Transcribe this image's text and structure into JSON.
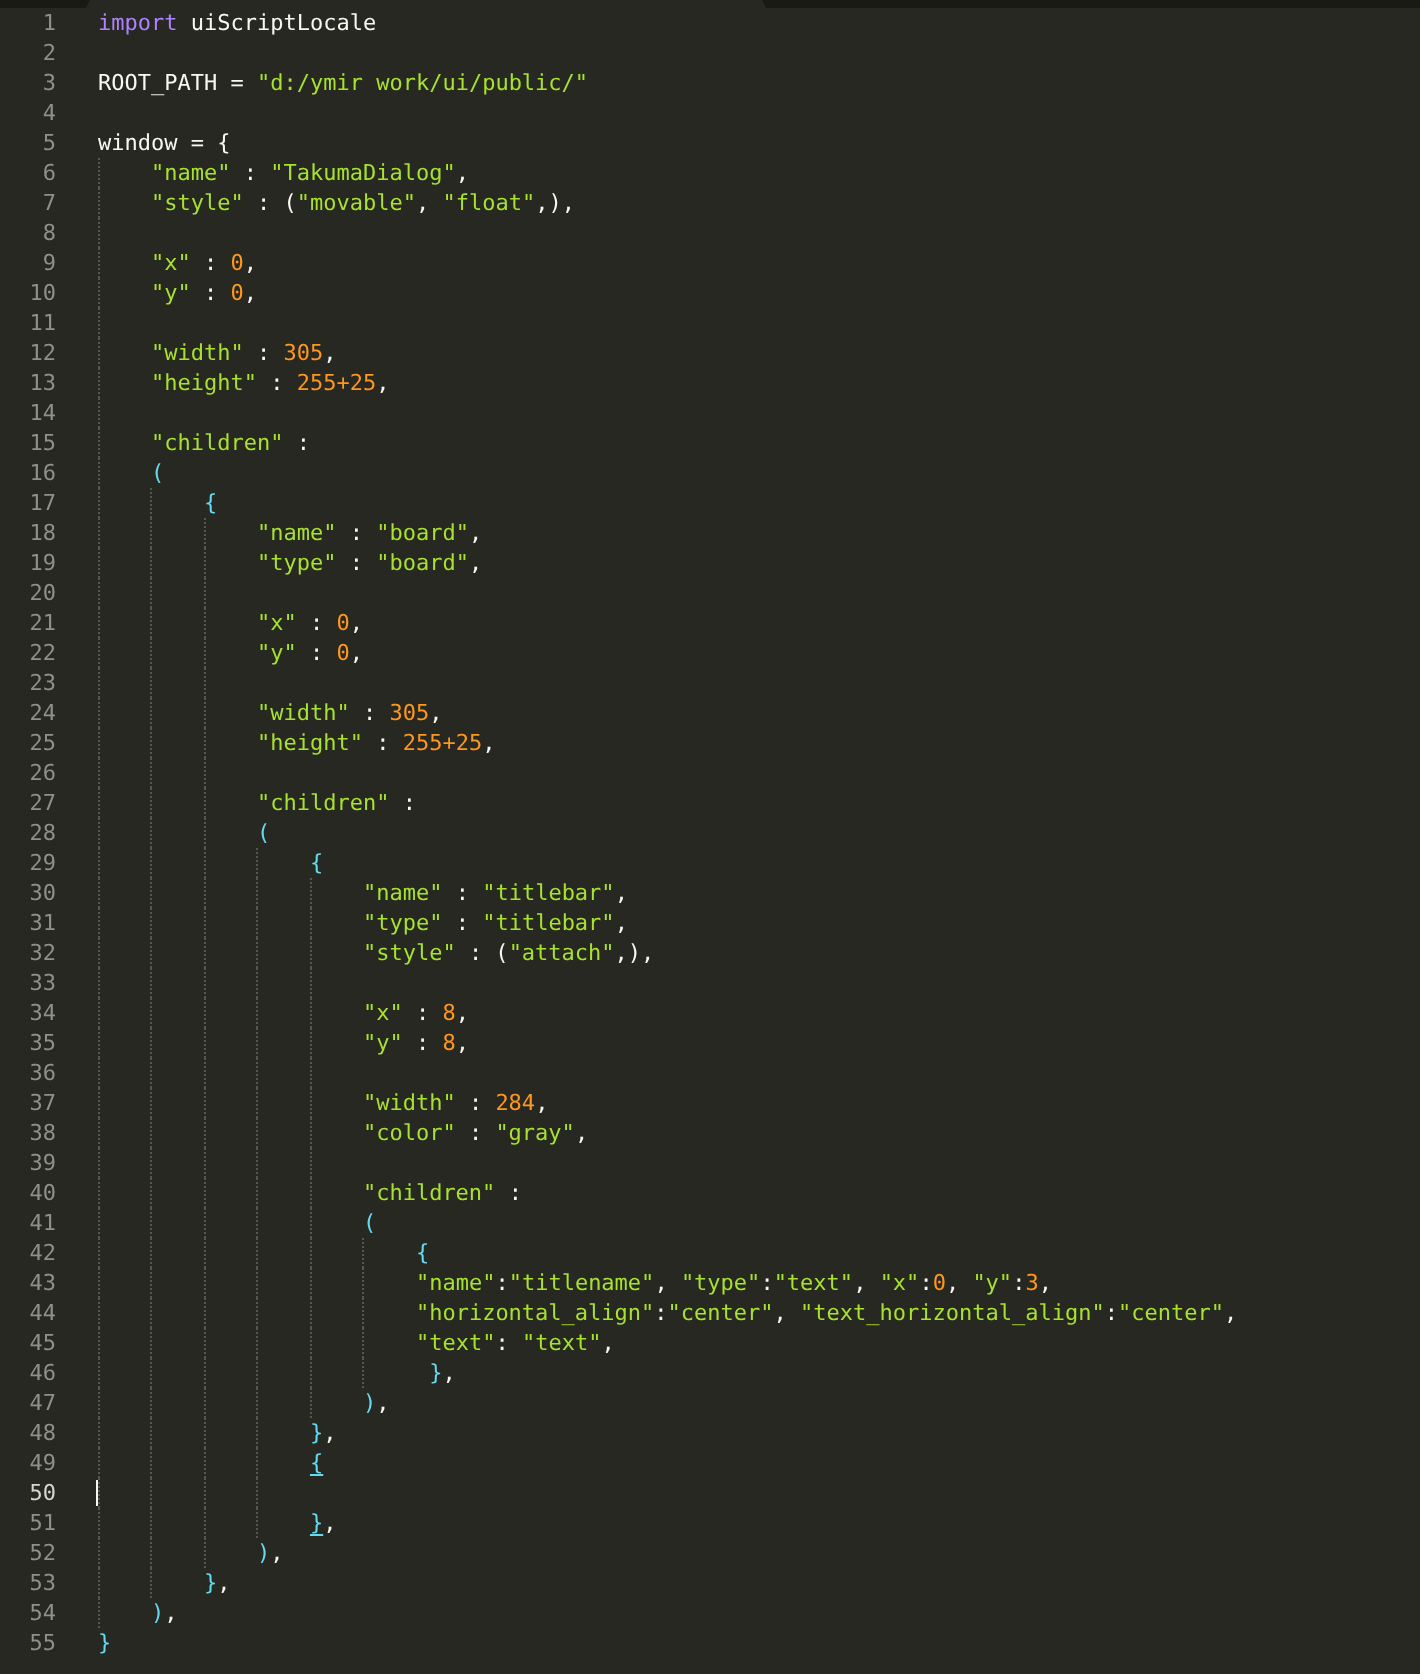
{
  "tab_bar": {
    "tab": {
      "selected": true
    }
  },
  "lines": [
    {
      "number": "1",
      "current": false,
      "tokens": [
        {
          "kind": "keyword",
          "text": "import"
        },
        {
          "kind": "plain",
          "text": " uiScriptLocale"
        }
      ]
    },
    {
      "number": "2",
      "current": false
    },
    {
      "number": "3",
      "current": false,
      "tokens": [
        {
          "kind": "plain",
          "text": "ROOT_PATH = "
        },
        {
          "kind": "string",
          "text": "\"d:/ymir work/ui/public/\""
        }
      ]
    },
    {
      "number": "4",
      "current": false
    },
    {
      "number": "5",
      "current": false,
      "tokens": [
        {
          "kind": "plain",
          "text": "window = {"
        }
      ]
    },
    {
      "number": "6",
      "current": false,
      "tokens": [
        {
          "kind": "string",
          "text": "    \"name\""
        },
        {
          "kind": "plain",
          "text": " : "
        },
        {
          "kind": "string",
          "text": "\"TakumaDialog\""
        },
        {
          "kind": "plain",
          "text": ","
        }
      ]
    },
    {
      "number": "7",
      "current": false,
      "tokens": [
        {
          "kind": "string",
          "text": "    \"style\""
        },
        {
          "kind": "plain",
          "text": " : ("
        },
        {
          "kind": "string",
          "text": "\"movable\""
        },
        {
          "kind": "plain",
          "text": ", "
        },
        {
          "kind": "string",
          "text": "\"float\""
        },
        {
          "kind": "plain",
          "text": ",),"
        }
      ]
    },
    {
      "number": "8",
      "current": false
    },
    {
      "number": "9",
      "current": false,
      "tokens": [
        {
          "kind": "string",
          "text": "    \"x\""
        },
        {
          "kind": "plain",
          "text": " : "
        },
        {
          "kind": "number",
          "text": "0"
        },
        {
          "kind": "plain",
          "text": ","
        }
      ]
    },
    {
      "number": "10",
      "current": false,
      "tokens": [
        {
          "kind": "string",
          "text": "    \"y\""
        },
        {
          "kind": "plain",
          "text": " : "
        },
        {
          "kind": "number",
          "text": "0"
        },
        {
          "kind": "plain",
          "text": ","
        }
      ]
    },
    {
      "number": "11",
      "current": false
    },
    {
      "number": "12",
      "current": false,
      "tokens": [
        {
          "kind": "string",
          "text": "    \"width\""
        },
        {
          "kind": "plain",
          "text": " : "
        },
        {
          "kind": "number",
          "text": "305"
        },
        {
          "kind": "plain",
          "text": ","
        }
      ]
    },
    {
      "number": "13",
      "current": false,
      "tokens": [
        {
          "kind": "string",
          "text": "    \"height\""
        },
        {
          "kind": "plain",
          "text": " : "
        },
        {
          "kind": "number",
          "text": "255+25"
        },
        {
          "kind": "plain",
          "text": ","
        }
      ]
    },
    {
      "number": "14",
      "current": false
    },
    {
      "number": "15",
      "current": false,
      "tokens": [
        {
          "kind": "string",
          "text": "    \"children\""
        },
        {
          "kind": "plain",
          "text": " :"
        }
      ]
    },
    {
      "number": "16",
      "current": false,
      "tokens": [
        {
          "kind": "bracket",
          "text": "    ("
        }
      ]
    },
    {
      "number": "17",
      "current": false,
      "tokens": [
        {
          "kind": "bracket",
          "text": "        {"
        }
      ]
    },
    {
      "number": "18",
      "current": false,
      "tokens": [
        {
          "kind": "string",
          "text": "            \"name\""
        },
        {
          "kind": "plain",
          "text": " : "
        },
        {
          "kind": "string",
          "text": "\"board\""
        },
        {
          "kind": "plain",
          "text": ","
        }
      ]
    },
    {
      "number": "19",
      "current": false,
      "tokens": [
        {
          "kind": "string",
          "text": "            \"type\""
        },
        {
          "kind": "plain",
          "text": " : "
        },
        {
          "kind": "string",
          "text": "\"board\""
        },
        {
          "kind": "plain",
          "text": ","
        }
      ]
    },
    {
      "number": "20",
      "current": false
    },
    {
      "number": "21",
      "current": false,
      "tokens": [
        {
          "kind": "string",
          "text": "            \"x\""
        },
        {
          "kind": "plain",
          "text": " : "
        },
        {
          "kind": "number",
          "text": "0"
        },
        {
          "kind": "plain",
          "text": ","
        }
      ]
    },
    {
      "number": "22",
      "current": false,
      "tokens": [
        {
          "kind": "string",
          "text": "            \"y\""
        },
        {
          "kind": "plain",
          "text": " : "
        },
        {
          "kind": "number",
          "text": "0"
        },
        {
          "kind": "plain",
          "text": ","
        }
      ]
    },
    {
      "number": "23",
      "current": false
    },
    {
      "number": "24",
      "current": false,
      "tokens": [
        {
          "kind": "string",
          "text": "            \"width\""
        },
        {
          "kind": "plain",
          "text": " : "
        },
        {
          "kind": "number",
          "text": "305"
        },
        {
          "kind": "plain",
          "text": ","
        }
      ]
    },
    {
      "number": "25",
      "current": false,
      "tokens": [
        {
          "kind": "string",
          "text": "            \"height\""
        },
        {
          "kind": "plain",
          "text": " : "
        },
        {
          "kind": "number",
          "text": "255+25"
        },
        {
          "kind": "plain",
          "text": ","
        }
      ]
    },
    {
      "number": "26",
      "current": false
    },
    {
      "number": "27",
      "current": false,
      "tokens": [
        {
          "kind": "string",
          "text": "            \"children\""
        },
        {
          "kind": "plain",
          "text": " :"
        }
      ]
    },
    {
      "number": "28",
      "current": false,
      "tokens": [
        {
          "kind": "bracket",
          "text": "            ("
        }
      ]
    },
    {
      "number": "29",
      "current": false,
      "tokens": [
        {
          "kind": "bracket",
          "text": "                {"
        }
      ]
    },
    {
      "number": "30",
      "current": false,
      "tokens": [
        {
          "kind": "string",
          "text": "                    \"name\""
        },
        {
          "kind": "plain",
          "text": " : "
        },
        {
          "kind": "string",
          "text": "\"titlebar\""
        },
        {
          "kind": "plain",
          "text": ","
        }
      ]
    },
    {
      "number": "31",
      "current": false,
      "tokens": [
        {
          "kind": "string",
          "text": "                    \"type\""
        },
        {
          "kind": "plain",
          "text": " : "
        },
        {
          "kind": "string",
          "text": "\"titlebar\""
        },
        {
          "kind": "plain",
          "text": ","
        }
      ]
    },
    {
      "number": "32",
      "current": false,
      "tokens": [
        {
          "kind": "string",
          "text": "                    \"style\""
        },
        {
          "kind": "plain",
          "text": " : ("
        },
        {
          "kind": "string",
          "text": "\"attach\""
        },
        {
          "kind": "plain",
          "text": ",),"
        }
      ]
    },
    {
      "number": "33",
      "current": false
    },
    {
      "number": "34",
      "current": false,
      "tokens": [
        {
          "kind": "string",
          "text": "                    \"x\""
        },
        {
          "kind": "plain",
          "text": " : "
        },
        {
          "kind": "number",
          "text": "8"
        },
        {
          "kind": "plain",
          "text": ","
        }
      ]
    },
    {
      "number": "35",
      "current": false,
      "tokens": [
        {
          "kind": "string",
          "text": "                    \"y\""
        },
        {
          "kind": "plain",
          "text": " : "
        },
        {
          "kind": "number",
          "text": "8"
        },
        {
          "kind": "plain",
          "text": ","
        }
      ]
    },
    {
      "number": "36",
      "current": false
    },
    {
      "number": "37",
      "current": false,
      "tokens": [
        {
          "kind": "string",
          "text": "                    \"width\""
        },
        {
          "kind": "plain",
          "text": " : "
        },
        {
          "kind": "number",
          "text": "284"
        },
        {
          "kind": "plain",
          "text": ","
        }
      ]
    },
    {
      "number": "38",
      "current": false,
      "tokens": [
        {
          "kind": "string",
          "text": "                    \"color\""
        },
        {
          "kind": "plain",
          "text": " : "
        },
        {
          "kind": "string",
          "text": "\"gray\""
        },
        {
          "kind": "plain",
          "text": ","
        }
      ]
    },
    {
      "number": "39",
      "current": false
    },
    {
      "number": "40",
      "current": false,
      "tokens": [
        {
          "kind": "string",
          "text": "                    \"children\""
        },
        {
          "kind": "plain",
          "text": " :"
        }
      ]
    },
    {
      "number": "41",
      "current": false,
      "tokens": [
        {
          "kind": "bracket",
          "text": "                    ("
        }
      ]
    },
    {
      "number": "42",
      "current": false,
      "tokens": [
        {
          "kind": "bracket",
          "text": "                        {"
        }
      ]
    },
    {
      "number": "43",
      "current": false,
      "tokens": [
        {
          "kind": "string",
          "text": "                        \"name\""
        },
        {
          "kind": "plain",
          "text": ":"
        },
        {
          "kind": "string",
          "text": "\"titlename\""
        },
        {
          "kind": "plain",
          "text": ", "
        },
        {
          "kind": "string",
          "text": "\"type\""
        },
        {
          "kind": "plain",
          "text": ":"
        },
        {
          "kind": "string",
          "text": "\"text\""
        },
        {
          "kind": "plain",
          "text": ", "
        },
        {
          "kind": "string",
          "text": "\"x\""
        },
        {
          "kind": "plain",
          "text": ":"
        },
        {
          "kind": "number",
          "text": "0"
        },
        {
          "kind": "plain",
          "text": ", "
        },
        {
          "kind": "string",
          "text": "\"y\""
        },
        {
          "kind": "plain",
          "text": ":"
        },
        {
          "kind": "number",
          "text": "3"
        },
        {
          "kind": "plain",
          "text": ","
        }
      ]
    },
    {
      "number": "44",
      "current": false,
      "tokens": [
        {
          "kind": "string",
          "text": "                        \"horizontal_align\""
        },
        {
          "kind": "plain",
          "text": ":"
        },
        {
          "kind": "string",
          "text": "\"center\""
        },
        {
          "kind": "plain",
          "text": ", "
        },
        {
          "kind": "string",
          "text": "\"text_horizontal_align\""
        },
        {
          "kind": "plain",
          "text": ":"
        },
        {
          "kind": "string",
          "text": "\"center\""
        },
        {
          "kind": "plain",
          "text": ","
        }
      ]
    },
    {
      "number": "45",
      "current": false,
      "tokens": [
        {
          "kind": "string",
          "text": "                        \"text\""
        },
        {
          "kind": "plain",
          "text": ": "
        },
        {
          "kind": "string",
          "text": "\"text\""
        },
        {
          "kind": "plain",
          "text": ","
        }
      ]
    },
    {
      "number": "46",
      "current": false,
      "tokens": [
        {
          "kind": "bracket",
          "text": "                         }"
        },
        {
          "kind": "plain",
          "text": ","
        }
      ]
    },
    {
      "number": "47",
      "current": false,
      "tokens": [
        {
          "kind": "bracket",
          "text": "                    )"
        },
        {
          "kind": "plain",
          "text": ","
        }
      ]
    },
    {
      "number": "48",
      "current": false,
      "tokens": [
        {
          "kind": "bracket",
          "text": "                }"
        },
        {
          "kind": "plain",
          "text": ","
        }
      ]
    },
    {
      "number": "49",
      "current": false,
      "tokens": [
        {
          "kind": "matched_bracket",
          "text": "                {"
        }
      ]
    },
    {
      "number": "50",
      "current": true
    },
    {
      "number": "51",
      "current": false,
      "tokens": [
        {
          "kind": "matched_bracket",
          "text": "                }"
        },
        {
          "kind": "plain",
          "text": ","
        }
      ]
    },
    {
      "number": "52",
      "current": false,
      "tokens": [
        {
          "kind": "bracket",
          "text": "            )"
        },
        {
          "kind": "plain",
          "text": ","
        }
      ]
    },
    {
      "number": "53",
      "current": false,
      "tokens": [
        {
          "kind": "bracket",
          "text": "        }"
        },
        {
          "kind": "plain",
          "text": ","
        }
      ]
    },
    {
      "number": "54",
      "current": false,
      "tokens": [
        {
          "kind": "bracket",
          "text": "    )"
        },
        {
          "kind": "plain",
          "text": ","
        }
      ]
    },
    {
      "number": "55",
      "current": false,
      "tokens": [
        {
          "kind": "bracket",
          "text": "}"
        }
      ]
    }
  ]
}
